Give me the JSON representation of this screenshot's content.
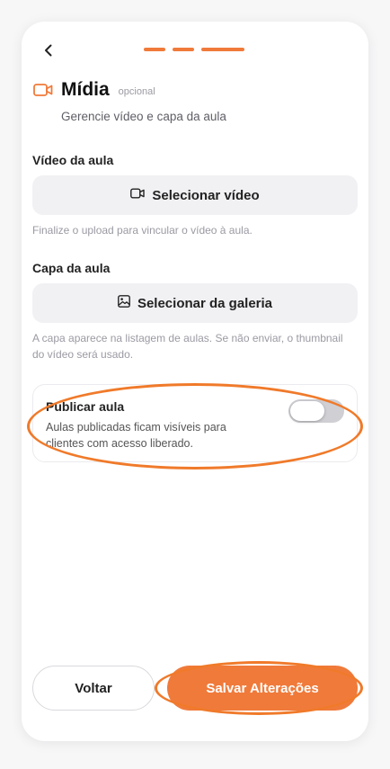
{
  "header": {
    "back_icon": "chevron-left-icon",
    "progress_steps": 3,
    "accent_color": "#f07a3a"
  },
  "section": {
    "icon": "video-camera-icon",
    "title": "Mídia",
    "optional_label": "opcional",
    "subtitle": "Gerencie vídeo e capa da aula"
  },
  "video": {
    "label": "Vídeo da aula",
    "button_icon": "video-camera-icon",
    "button_label": "Selecionar vídeo",
    "hint": "Finalize o upload para vincular o vídeo à aula."
  },
  "cover": {
    "label": "Capa da aula",
    "button_icon": "image-icon",
    "button_label": "Selecionar da galeria",
    "hint": "A capa aparece na listagem de aulas. Se não enviar, o thumbnail do vídeo será usado."
  },
  "publish": {
    "title": "Publicar aula",
    "description": "Aulas publicadas ficam visíveis para clientes com acesso liberado.",
    "enabled": false
  },
  "footer": {
    "back_label": "Voltar",
    "save_label": "Salvar Alterações"
  },
  "annotation_color": "#f07a2a"
}
